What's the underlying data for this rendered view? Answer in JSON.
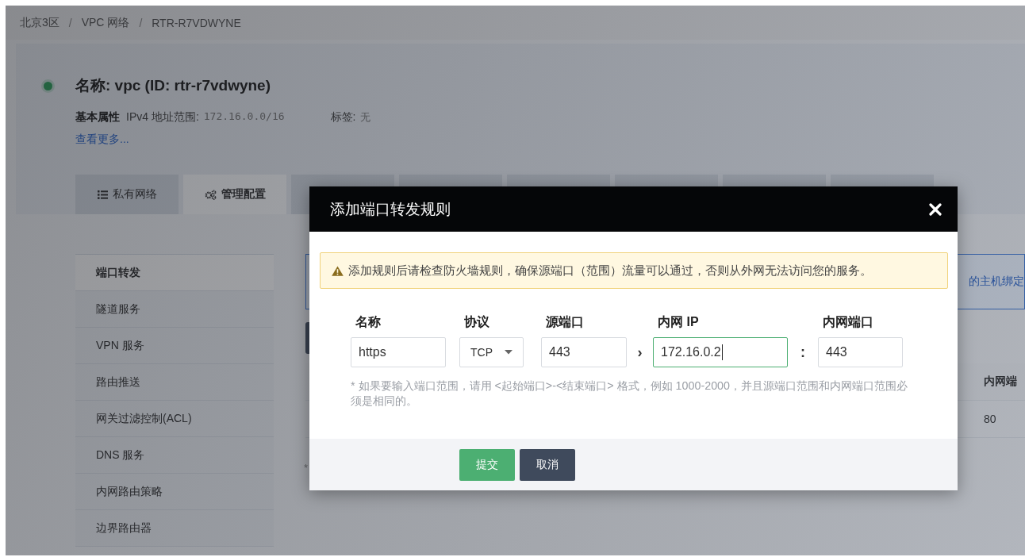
{
  "breadcrumb": {
    "items": [
      "北京3区",
      "VPC 网络",
      "RTR-R7VDWYNE"
    ],
    "separator": "/"
  },
  "header": {
    "running": true,
    "title": "名称: vpc (ID: rtr-r7vdwyne)",
    "section_label": "基本属性",
    "properties": [
      {
        "label": "IPv4 地址范围:",
        "value": "172.16.0.0/16"
      },
      {
        "label": "标签:",
        "value": "无"
      }
    ],
    "more_link": "查看更多..."
  },
  "tabs": [
    {
      "kind": "list",
      "label": "私有网络",
      "selected": false
    },
    {
      "kind": "gears",
      "label": "管理配置",
      "selected": true
    },
    {
      "kind": "blank",
      "selected": false
    },
    {
      "kind": "blank",
      "selected": false
    },
    {
      "kind": "blank",
      "selected": false
    },
    {
      "kind": "blank",
      "selected": false
    },
    {
      "kind": "blank",
      "selected": false
    },
    {
      "kind": "blank",
      "selected": false
    }
  ],
  "sidebar": {
    "items": [
      {
        "label": "端口转发",
        "selected": true
      },
      {
        "label": "隧道服务",
        "selected": false
      },
      {
        "label": "VPN 服务",
        "selected": false
      },
      {
        "label": "路由推送",
        "selected": false
      },
      {
        "label": "网关过滤控制(ACL)",
        "selected": false
      },
      {
        "label": "DNS 服务",
        "selected": false
      },
      {
        "label": "内网路由策略",
        "selected": false
      },
      {
        "label": "边界路由器",
        "selected": false
      }
    ]
  },
  "content": {
    "notice": "的主机绑定",
    "table": {
      "column_header": "内网端",
      "cell": "80"
    },
    "footnote": "*"
  },
  "modal": {
    "title": "添加端口转发规则",
    "warning": "添加规则后请检查防火墙规则，确保源端口（范围）流量可以通过，否则从外网无法访问您的服务。",
    "fields": [
      {
        "kind": "text",
        "label": "名称",
        "value": "https",
        "focused": false
      },
      {
        "kind": "select",
        "label": "协议",
        "value": "TCP",
        "focused": false
      },
      {
        "kind": "text",
        "label": "源端口",
        "value": "443",
        "focused": false,
        "joiner": "›"
      },
      {
        "kind": "text",
        "label": "内网 IP",
        "value": "172.16.0.2",
        "focused": true,
        "joiner": ":"
      },
      {
        "kind": "text",
        "label": "内网端口",
        "value": "443",
        "focused": false
      }
    ],
    "hint": "* 如果要输入端口范围，请用 <起始端口>-<结束端口> 格式，例如 1000-2000，并且源端口范围和内网端口范围必须是相同的。",
    "buttons": [
      {
        "kind": "primary",
        "label": "提交"
      },
      {
        "kind": "secondary",
        "label": "取消"
      }
    ]
  }
}
